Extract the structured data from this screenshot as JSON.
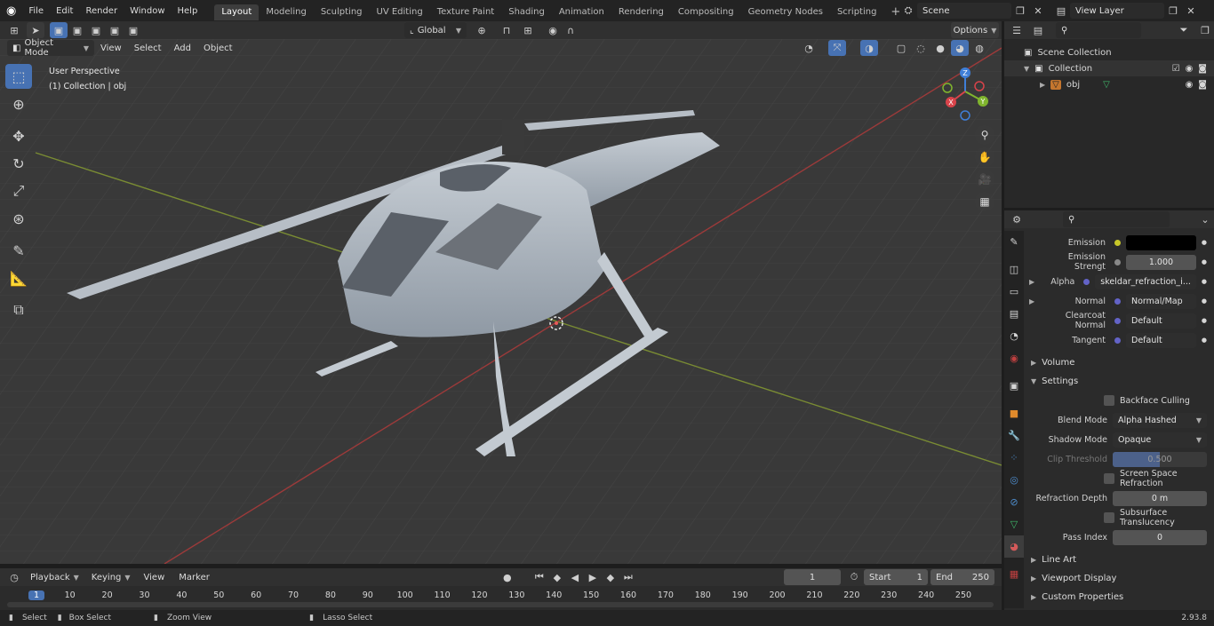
{
  "menu": {
    "file": "File",
    "edit": "Edit",
    "render": "Render",
    "window": "Window",
    "help": "Help"
  },
  "workspaces": [
    "Layout",
    "Modeling",
    "Sculpting",
    "UV Editing",
    "Texture Paint",
    "Shading",
    "Animation",
    "Rendering",
    "Compositing",
    "Geometry Nodes",
    "Scripting"
  ],
  "active_workspace": "Layout",
  "scene": {
    "name": "Scene",
    "view_layer": "View Layer"
  },
  "viewport_header": {
    "mode": "Object Mode",
    "view": "View",
    "select": "Select",
    "add": "Add",
    "object": "Object",
    "transform": "Global",
    "options": "Options"
  },
  "viewport": {
    "perspective": "User Perspective",
    "collection_info": "(1) Collection | obj"
  },
  "gizmo": {
    "x": "X",
    "y": "Y",
    "z": "Z"
  },
  "outliner": {
    "scene_collection": "Scene Collection",
    "collection": "Collection",
    "object": "obj"
  },
  "properties": {
    "rows": [
      {
        "label": "Emission",
        "value": "",
        "dot": "#c7c729",
        "kind": "color"
      },
      {
        "label": "Emission Strengt",
        "value": "1.000",
        "dot": "#888888",
        "kind": "num"
      },
      {
        "label": "Alpha",
        "value": "skeldar_refraction_i...",
        "dot": "#6363c7",
        "kind": "dark",
        "expand": true
      },
      {
        "label": "Normal",
        "value": "Normal/Map",
        "dot": "#6363c7",
        "kind": "dark",
        "expand": true
      },
      {
        "label": "Clearcoat Normal",
        "value": "Default",
        "dot": "#6363c7",
        "kind": "dark"
      },
      {
        "label": "Tangent",
        "value": "Default",
        "dot": "#6363c7",
        "kind": "dark"
      }
    ],
    "volume": "Volume",
    "settings": "Settings",
    "backface_culling": "Backface Culling",
    "blend_mode_label": "Blend Mode",
    "blend_mode": "Alpha Hashed",
    "shadow_mode_label": "Shadow Mode",
    "shadow_mode": "Opaque",
    "clip_threshold_label": "Clip Threshold",
    "clip_threshold": "0.500",
    "clip_fraction": 0.5,
    "ssr": "Screen Space Refraction",
    "refraction_depth_label": "Refraction Depth",
    "refraction_depth": "0 m",
    "subsurface": "Subsurface Translucency",
    "pass_index_label": "Pass Index",
    "pass_index": "0",
    "line_art": "Line Art",
    "viewport_display": "Viewport Display",
    "custom_properties": "Custom Properties"
  },
  "timeline": {
    "playback": "Playback",
    "keying": "Keying",
    "view": "View",
    "marker": "Marker",
    "current_frame": "1",
    "start_label": "Start",
    "start": "1",
    "end_label": "End",
    "end": "250",
    "frames": [
      "1",
      "10",
      "20",
      "30",
      "40",
      "50",
      "60",
      "70",
      "80",
      "90",
      "100",
      "110",
      "120",
      "130",
      "140",
      "150",
      "160",
      "170",
      "180",
      "190",
      "200",
      "210",
      "220",
      "230",
      "240",
      "250"
    ]
  },
  "status": {
    "select": "Select",
    "box_select": "Box Select",
    "zoom_view": "Zoom View",
    "lasso_select": "Lasso Select",
    "version": "2.93.8"
  }
}
